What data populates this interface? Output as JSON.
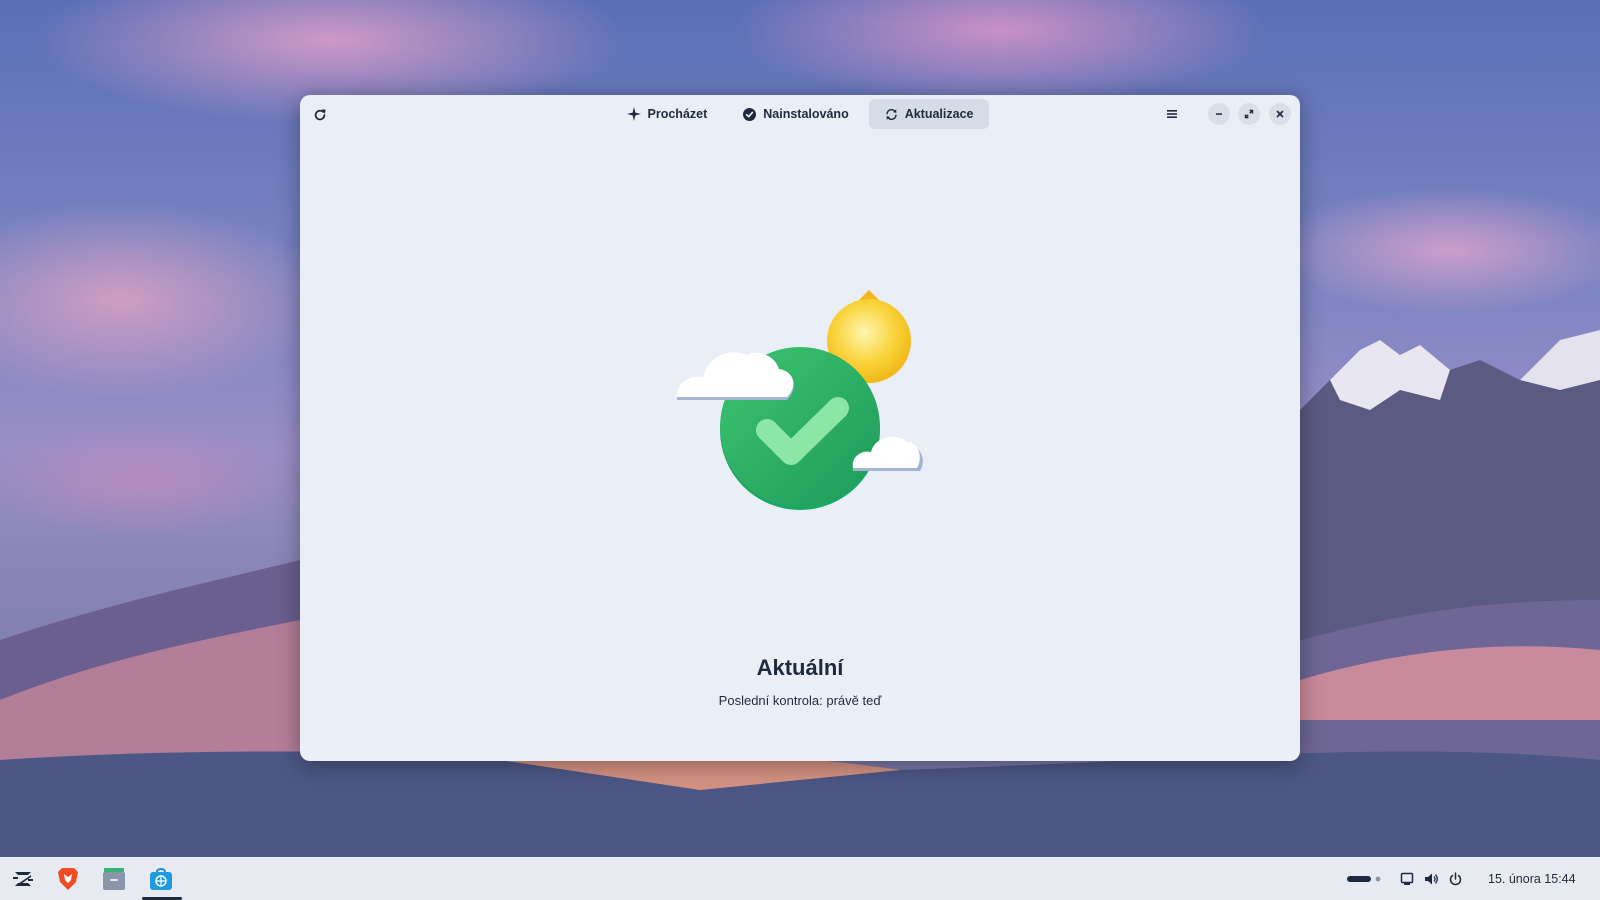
{
  "window": {
    "tabs": [
      {
        "label": "Procházet",
        "icon": "sparkle-icon",
        "active": false
      },
      {
        "label": "Nainstalováno",
        "icon": "check-circle-icon",
        "active": false
      },
      {
        "label": "Aktualizace",
        "icon": "sync-icon",
        "active": true
      }
    ],
    "toolbar": {
      "refresh_icon": "refresh-icon",
      "menu_icon": "hamburger-menu-icon",
      "minimize_icon": "minimize-icon",
      "maximize_icon": "maximize-icon",
      "close_icon": "close-icon"
    },
    "status": {
      "title": "Aktuální",
      "subtitle": "Poslední kontrola: právě teď",
      "illustration": "up-to-date-checkmark-sun-clouds"
    }
  },
  "taskbar": {
    "apps": [
      {
        "name": "Zorin menu",
        "icon": "zorin-logo-icon",
        "active": false
      },
      {
        "name": "Brave",
        "icon": "brave-browser-icon",
        "active": false
      },
      {
        "name": "Soubory",
        "icon": "file-manager-icon",
        "active": false
      },
      {
        "name": "Software",
        "icon": "software-store-icon",
        "active": true
      }
    ],
    "tray_icons": [
      "workspace-indicator-icon",
      "network-icon",
      "volume-icon",
      "power-icon"
    ],
    "clock": "15. února 15:44"
  },
  "colors": {
    "window_bg": "#eaeff7",
    "text": "#1f2a3c",
    "active_tab_bg": "#d5dce8",
    "check_green": "#27ae60",
    "sun_yellow": "#f6c21c"
  }
}
